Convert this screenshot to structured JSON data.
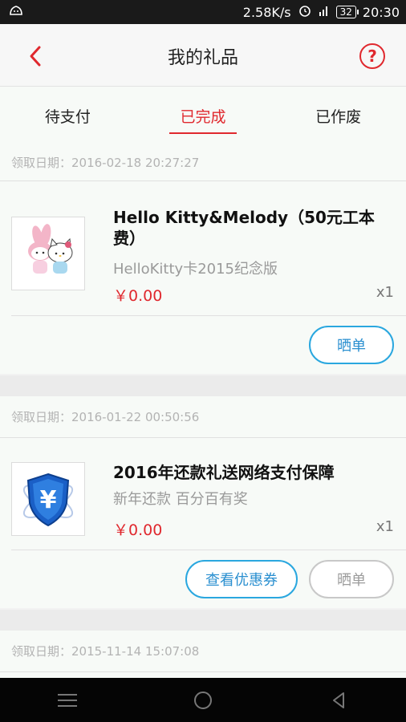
{
  "status_bar": {
    "speed": "2.58K/s",
    "battery": "32",
    "time": "20:30"
  },
  "header": {
    "title": "我的礼品",
    "help_label": "?"
  },
  "tabs": [
    {
      "label": "待支付",
      "active": false
    },
    {
      "label": "已完成",
      "active": true
    },
    {
      "label": "已作废",
      "active": false
    }
  ],
  "orders": [
    {
      "date": "领取日期：2016-02-18 20:27:27",
      "title": "Hello Kitty&Melody（50元工本费）",
      "subtitle": "HelloKitty卡2015纪念版",
      "price": "￥0.00",
      "qty": "x1",
      "actions": [
        "晒单"
      ]
    },
    {
      "date": "领取日期：2016-01-22 00:50:56",
      "title": "2016年还款礼送网络支付保障",
      "subtitle": "新年还款 百分百有奖",
      "price": "￥0.00",
      "qty": "x1",
      "actions": [
        "查看优惠券",
        "晒单"
      ]
    },
    {
      "date": "领取日期：2015-11-14 15:07:08"
    }
  ],
  "colors": {
    "accent_red": "#e0282e",
    "accent_blue": "#2aa7df"
  }
}
